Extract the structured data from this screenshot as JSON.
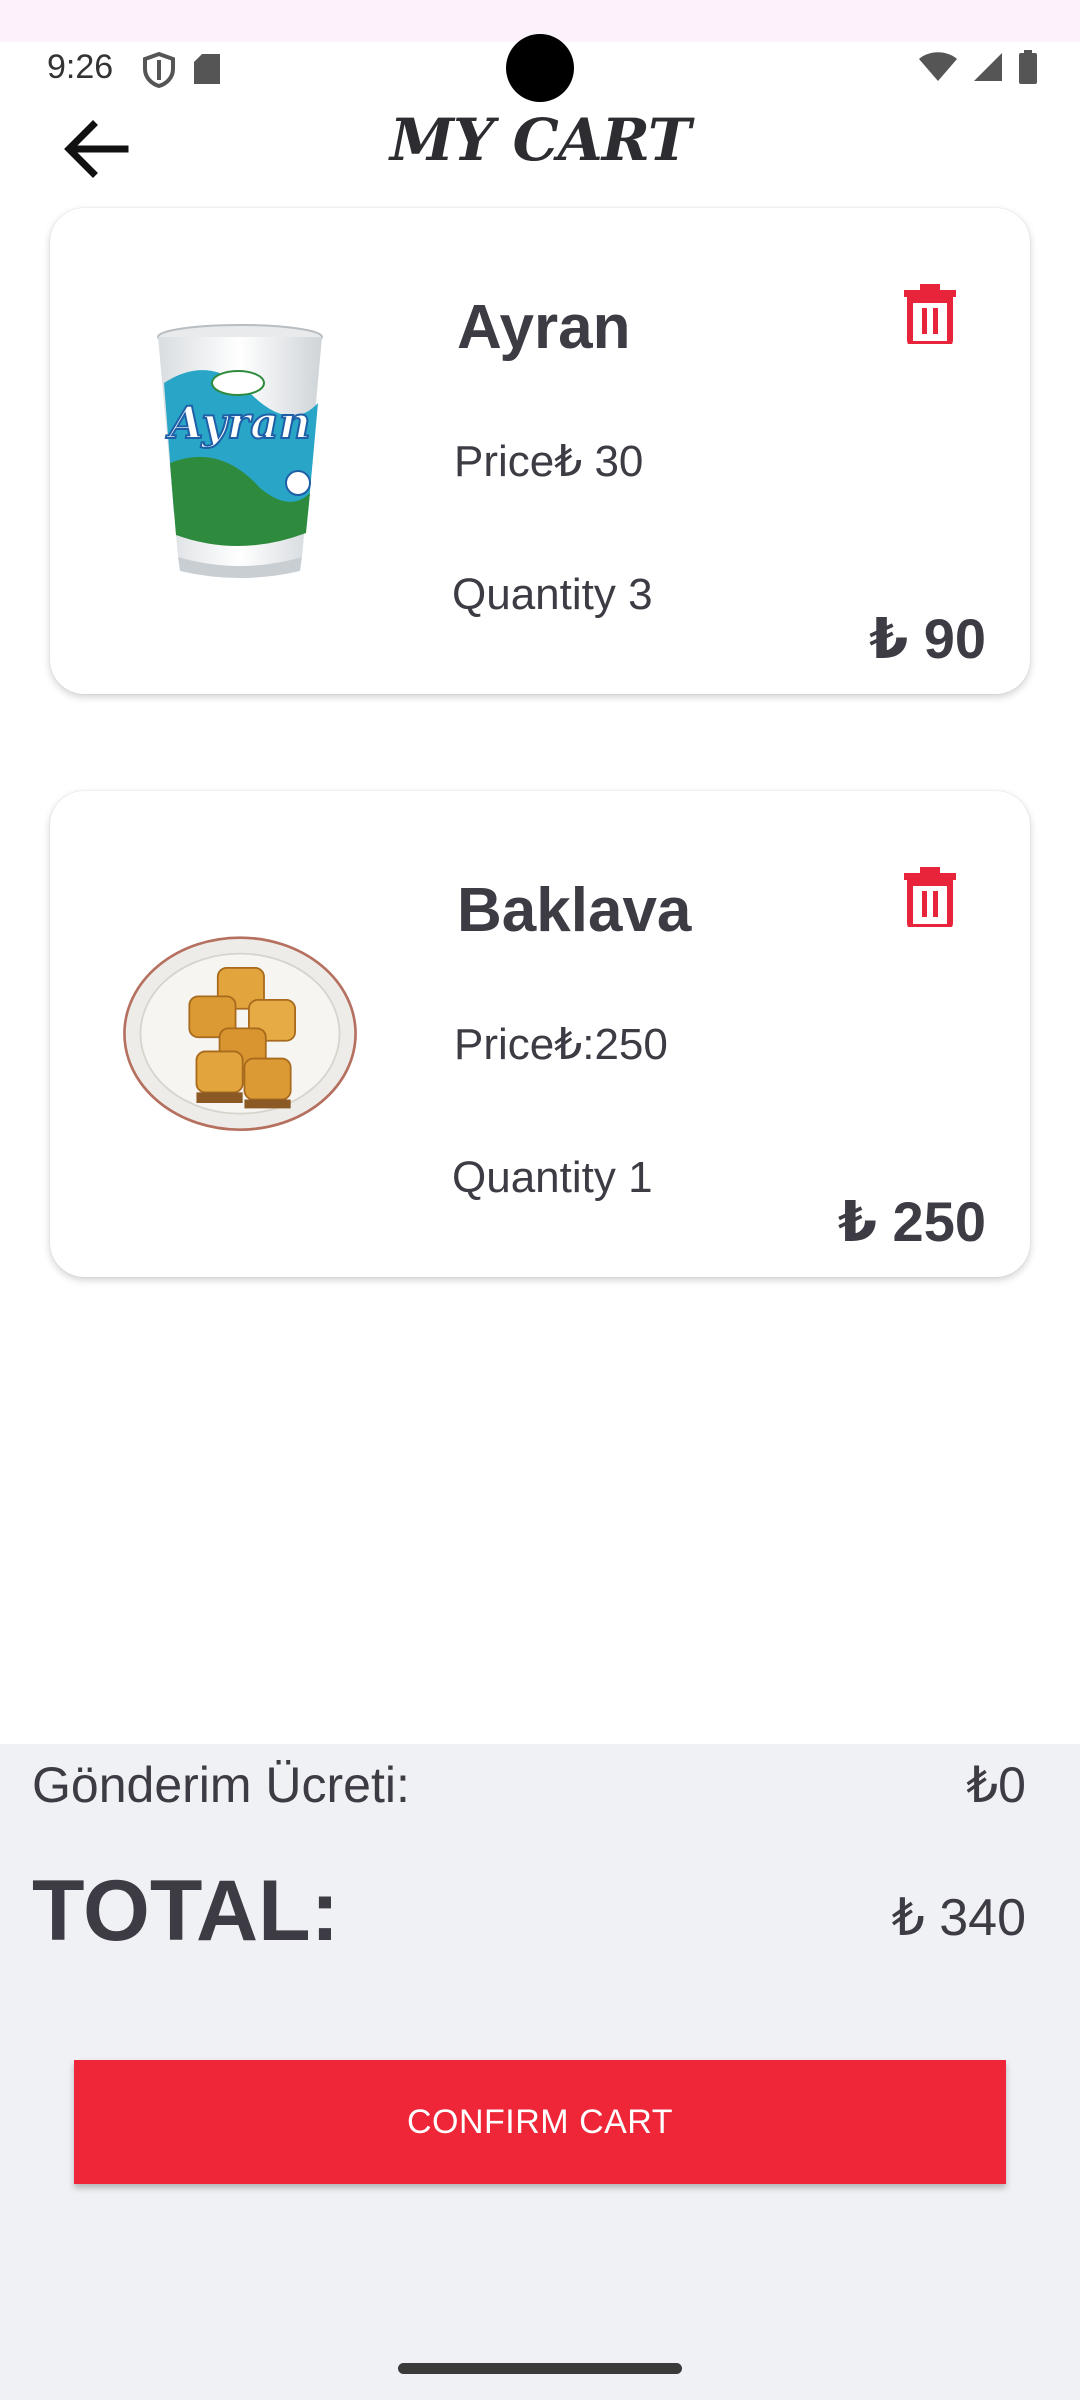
{
  "status_bar": {
    "time": "9:26",
    "icons": [
      "shield-icon",
      "sd-card-icon",
      "wifi-icon",
      "signal-icon",
      "battery-icon"
    ]
  },
  "header": {
    "title": "MY CART",
    "back_icon": "arrow-back-icon"
  },
  "cart_items": [
    {
      "name": "Ayran",
      "price_label": "Price₺ 30",
      "quantity_label": "Quantity 3",
      "line_total": "₺ 90",
      "image": "ayran-cup-image",
      "delete_icon": "trash-icon"
    },
    {
      "name": "Baklava",
      "price_label": "Price₺:250",
      "quantity_label": "Quantity 1",
      "line_total": "₺ 250",
      "image": "baklava-plate-image",
      "delete_icon": "trash-icon"
    }
  ],
  "summary": {
    "shipping_label": "Gönderim Ücreti:",
    "shipping_value": "₺0",
    "total_label": "TOTAL:",
    "total_value": "₺ 340",
    "confirm_label": "CONFIRM CART"
  },
  "colors": {
    "accent": "#ef2637",
    "text": "#3d3c44",
    "summary_bg": "#f0f1f4",
    "top_strip": "#fcf2fb"
  }
}
